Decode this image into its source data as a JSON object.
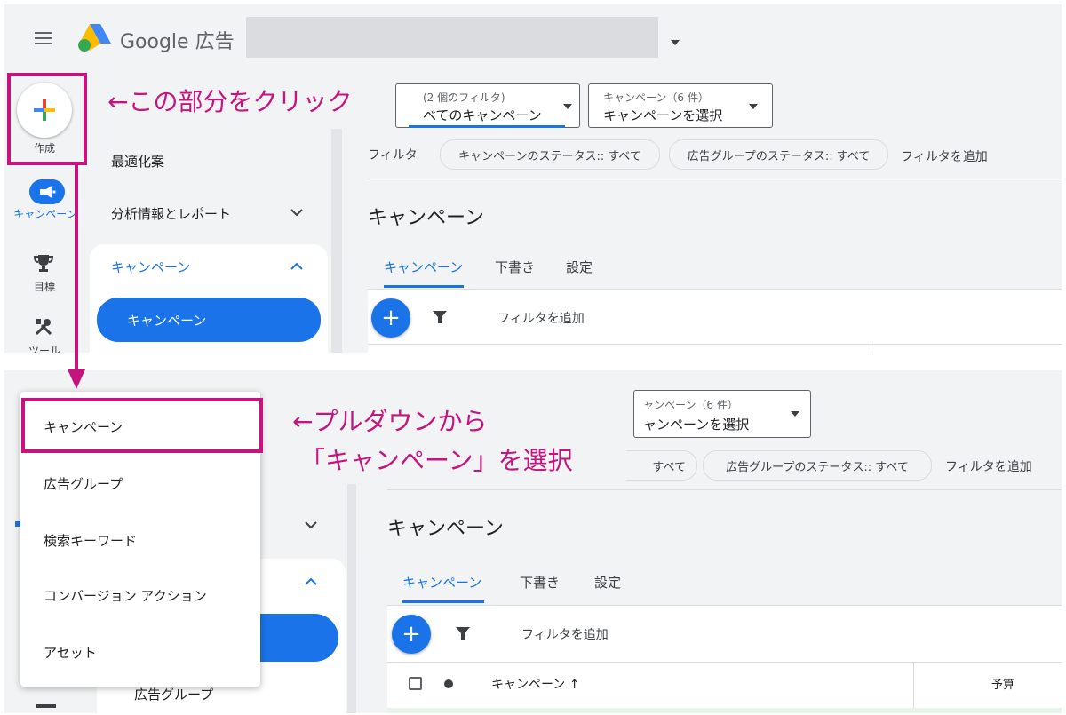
{
  "top": {
    "brand": "Google 広告",
    "create_label": "作成",
    "rail": [
      "キャンペーン",
      "目標",
      "ツール"
    ],
    "nav": {
      "recommendations": "最適化案",
      "insights": "分析情報とレポート",
      "campaigns": "キャンペーン",
      "campaigns_sub": "キャンペーン"
    },
    "filter_dropdown": {
      "small": "(2 個のフィルタ)",
      "big": "べてのキャンペーン"
    },
    "campaign_dropdown": {
      "small": "キャンペーン（6 件）",
      "big": "キャンペーンを選択"
    },
    "filter_bar": {
      "label": "フィルタ",
      "chip_status": "キャンペーンのステータス:: すべて",
      "chip_adgroup": "広告グループのステータス:: すべて",
      "add": "フィルタを追加"
    },
    "page_title": "キャンペーン",
    "tabs": [
      "キャンペーン",
      "下書き",
      "設定"
    ],
    "add_filter": "フィルタを追加",
    "callout": "←この部分をクリック"
  },
  "bottom": {
    "menu": [
      "キャンペーン",
      "広告グループ",
      "検索キーワード",
      "コンバージョン アクション",
      "アセット"
    ],
    "campaign_dropdown": {
      "small": "ャンペーン（6 件）",
      "big": "ャンペーンを選択"
    },
    "filter_bar": {
      "chip_status_tail": "すべて",
      "chip_adgroup": "広告グループのステータス:: すべて",
      "add": "フィルタを追加"
    },
    "page_title": "キャンペーン",
    "tabs": [
      "キャンペーン",
      "下書き",
      "設定"
    ],
    "add_filter": "フィルタを追加",
    "table_header": {
      "campaign": "キャンペーン ↑",
      "budget": "予算"
    },
    "sidebar_adgroup": "広告グループ",
    "callout_line1": "←プルダウンから",
    "callout_line2": "「キャンペーン」を選択"
  },
  "colors": {
    "accent": "#1a73e8",
    "highlight": "#c6137d",
    "panel": "#f1f3f4"
  }
}
